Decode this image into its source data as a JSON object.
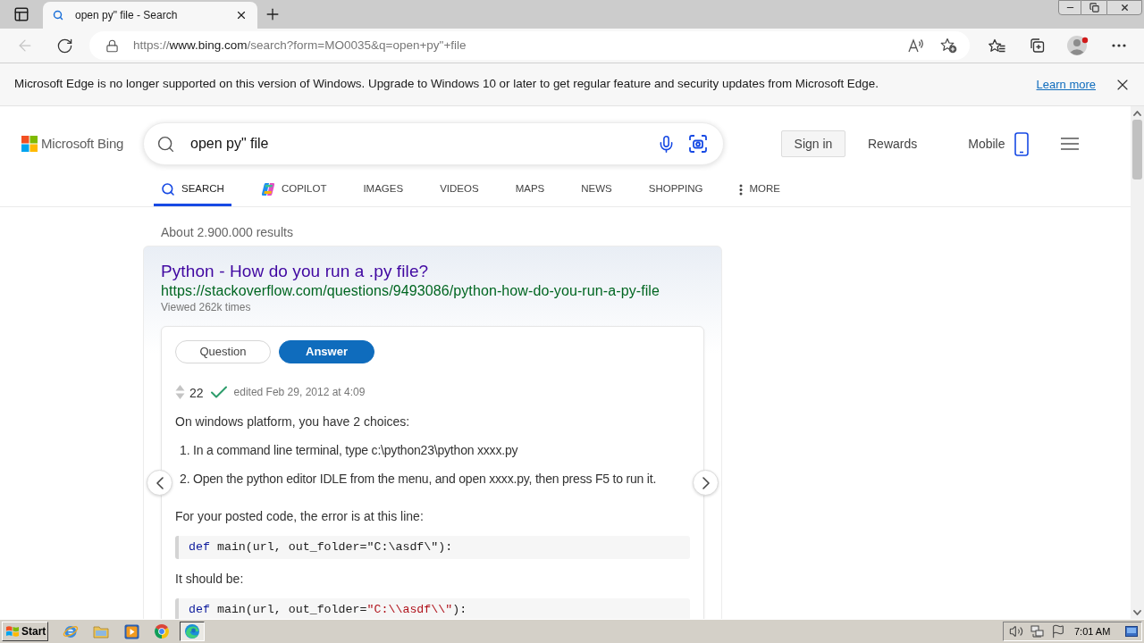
{
  "browser": {
    "tab": {
      "title": "open py\" file - Search"
    },
    "back": {
      "disabled": true
    },
    "address": {
      "scheme": "https://",
      "host": "www.bing.com",
      "path": "/search?form=MO0035&q=open+py\"+file"
    }
  },
  "notice": {
    "text": "Microsoft Edge is no longer supported on this version of Windows. Upgrade to Windows 10 or later to get regular feature and security updates from Microsoft Edge.",
    "link": "Learn more"
  },
  "header": {
    "logo": "Microsoft Bing",
    "query": "open py\" file",
    "sign_in": "Sign in",
    "rewards": "Rewards",
    "mobile": "Mobile"
  },
  "nav": [
    {
      "label": "SEARCH",
      "kind": "search",
      "selected": true
    },
    {
      "label": "COPILOT",
      "kind": "copilot",
      "selected": false
    },
    {
      "label": "IMAGES",
      "kind": "text",
      "selected": false
    },
    {
      "label": "VIDEOS",
      "kind": "text",
      "selected": false
    },
    {
      "label": "MAPS",
      "kind": "text",
      "selected": false
    },
    {
      "label": "NEWS",
      "kind": "text",
      "selected": false
    },
    {
      "label": "SHOPPING",
      "kind": "text",
      "selected": false
    },
    {
      "label": "MORE",
      "kind": "more",
      "selected": false
    }
  ],
  "results": {
    "count": "About 2.900.000 results",
    "card": {
      "title": "Python - How do you run a .py file?",
      "url": "https://stackoverflow.com/questions/9493086/python-how-do-you-run-a-py-file",
      "views": "Viewed 262k times",
      "toggles": [
        {
          "label": "Question",
          "selected": false
        },
        {
          "label": "Answer",
          "selected": true
        }
      ],
      "votes": "22",
      "accepted": true,
      "edited": "edited Feb 29, 2012 at 4:09",
      "body": [
        {
          "kind": "paragraph",
          "text": "On windows platform, you have 2 choices:"
        },
        {
          "kind": "list",
          "items": [
            {
              "number": "1.",
              "text": "In a command line terminal, type c:\\python23\\python xxxx.py"
            },
            {
              "number": "2.",
              "text": "Open the python editor IDLE from the menu, and open xxxx.py, then press F5 to run it."
            }
          ]
        },
        {
          "kind": "paragraph",
          "text": "For your posted code, the error is at this line:"
        },
        {
          "kind": "code",
          "tokens": [
            {
              "kind": "keyword",
              "text": "def"
            },
            {
              "kind": "plain",
              "text": " main(url, out_folder=\"C:\\asdf\\\"):"
            }
          ]
        },
        {
          "kind": "paragraph",
          "text": "It should be:"
        },
        {
          "kind": "code",
          "tokens": [
            {
              "kind": "keyword",
              "text": "def"
            },
            {
              "kind": "plain",
              "text": " main(url, out_folder="
            },
            {
              "kind": "string",
              "text": "\"C:\\\\asdf\\\\\""
            },
            {
              "kind": "plain",
              "text": "):"
            }
          ]
        }
      ]
    }
  },
  "taskbar": {
    "start": "Start",
    "apps": [
      {
        "selected": false
      },
      {
        "selected": false
      },
      {
        "selected": false
      },
      {
        "selected": false
      },
      {
        "selected": true
      }
    ],
    "clock": "7:01 AM"
  }
}
